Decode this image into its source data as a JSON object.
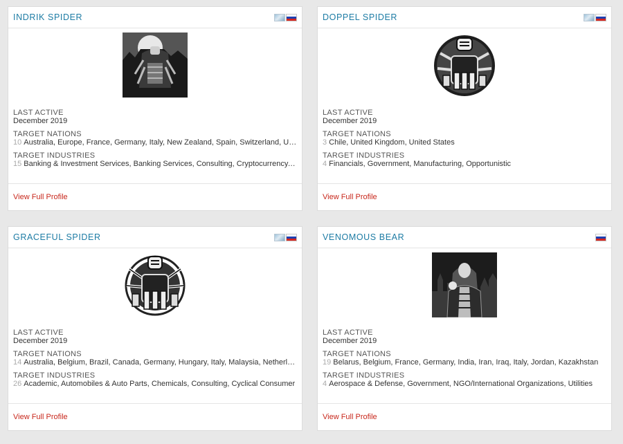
{
  "labels": {
    "last_active": "LAST ACTIVE",
    "target_nations": "TARGET NATIONS",
    "target_industries": "TARGET INDUSTRIES",
    "view_profile": "View Full Profile"
  },
  "cards": [
    {
      "name": "INDRIK SPIDER",
      "flags": [
        "ecrime-flag-icon",
        "russia-flag-icon"
      ],
      "portrait": "indrik-spider-portrait",
      "last_active": "December 2019",
      "nations_count": "10",
      "nations": "Australia, Europe, France, Germany, Italy, New Zealand, Spain, Switzerland, United Kingdom, United States",
      "industries_count": "15",
      "industries": "Banking & Investment Services, Banking Services, Consulting, Cryptocurrency, Financials"
    },
    {
      "name": "DOPPEL SPIDER",
      "flags": [
        "ecrime-flag-icon",
        "russia-flag-icon"
      ],
      "portrait": "doppel-spider-portrait",
      "last_active": "December 2019",
      "nations_count": "3",
      "nations": "Chile, United Kingdom, United States",
      "industries_count": "4",
      "industries": "Financials, Government, Manufacturing, Opportunistic"
    },
    {
      "name": "GRACEFUL SPIDER",
      "flags": [
        "ecrime-flag-icon",
        "russia-flag-icon"
      ],
      "portrait": "graceful-spider-portrait",
      "last_active": "December 2019",
      "nations_count": "14",
      "nations": "Australia, Belgium, Brazil, Canada, Germany, Hungary, Italy, Malaysia, Netherlands, Spain",
      "industries_count": "26",
      "industries": "Academic, Automobiles & Auto Parts, Chemicals, Consulting, Cyclical Consumer"
    },
    {
      "name": "VENOMOUS BEAR",
      "flags": [
        "russia-flag-icon"
      ],
      "portrait": "venomous-bear-portrait",
      "last_active": "December 2019",
      "nations_count": "19",
      "nations": "Belarus, Belgium, France, Germany, India, Iran, Iraq, Italy, Jordan, Kazakhstan",
      "industries_count": "4",
      "industries": "Aerospace & Defense, Government, NGO/International Organizations, Utilities"
    }
  ]
}
